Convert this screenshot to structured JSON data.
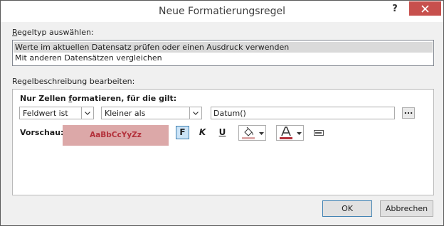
{
  "window": {
    "title": "Neue Formatierungsregel",
    "help_label": "?"
  },
  "rule_type": {
    "label_first": "R",
    "label_rest": "egeltyp auswählen:",
    "items": [
      {
        "label": "Werte im aktuellen Datensatz prüfen oder einen Ausdruck verwenden",
        "selected": true
      },
      {
        "label": "Mit anderen Datensätzen vergleichen",
        "selected": false
      }
    ]
  },
  "description": {
    "label": "Regelbeschreibung bearbeiten:",
    "condition_label_before": "Nur Zellen ",
    "condition_label_underlined": "f",
    "condition_label_after": "ormatieren, für die gilt:",
    "field_select": "Feldwert ist",
    "operator_select": "Kleiner als",
    "expression_value": "Datum()",
    "ellipsis_label": "...",
    "preview_label": "Vorschau:",
    "preview_text": "AaBbCcYyZz",
    "bold_label": "F",
    "italic_label": "K",
    "underline_label": "U"
  },
  "colors": {
    "fill_color": "#dca8a8",
    "font_color": "#b3303a",
    "close_button": "#c7504d",
    "selected_row": "#dadada"
  },
  "buttons": {
    "ok": "OK",
    "cancel": "Abbrechen"
  }
}
